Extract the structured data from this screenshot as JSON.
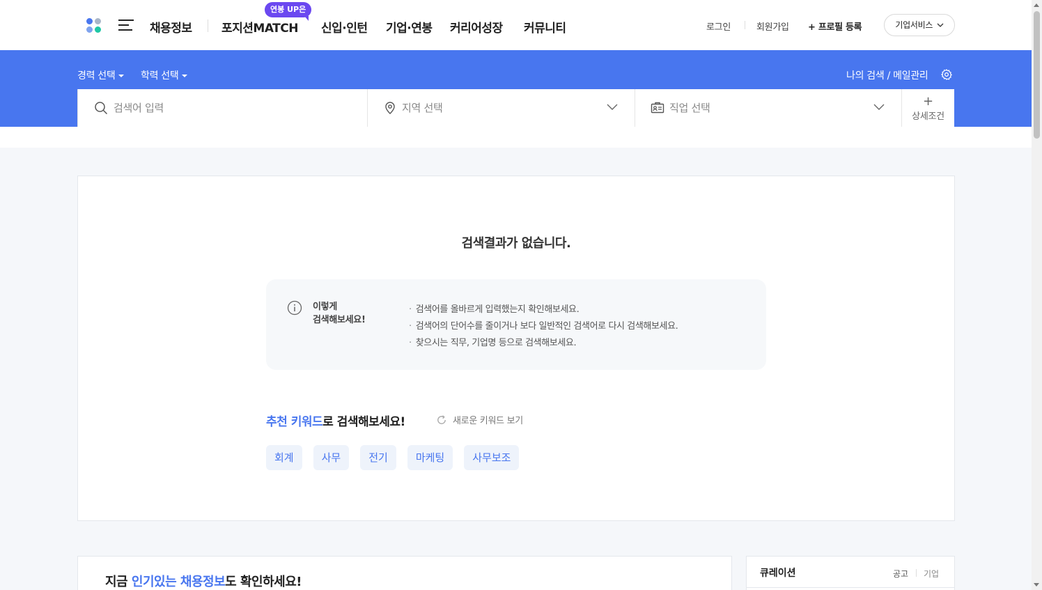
{
  "header": {
    "nav": [
      {
        "label": "채용정보"
      },
      {
        "label": "포지션MATCH"
      },
      {
        "label": "신입·인턴"
      },
      {
        "label": "기업·연봉"
      },
      {
        "label": "커리어성장"
      },
      {
        "label": "커뮤니티"
      }
    ],
    "match_badge": "연봉 UP은",
    "util": {
      "login": "로그인",
      "signup": "회원가입",
      "profile": "+ 프로필 등록",
      "biz": "기업서비스"
    },
    "logo_colors": [
      "#4876ef",
      "#a9b6c9",
      "#7fa3ee",
      "#1fc7a5"
    ]
  },
  "search": {
    "filters": {
      "career": "경력 선택",
      "education": "학력 선택"
    },
    "my_search": "나의 검색 / 메일관리",
    "keyword_placeholder": "검색어 입력",
    "region_placeholder": "지역 선택",
    "job_placeholder": "직업 선택",
    "detail_label": "상세조건"
  },
  "result": {
    "empty_message": "검색결과가 없습니다.",
    "tip_title_line1": "이렇게",
    "tip_title_line2": "검색해보세요!",
    "tips": [
      "검색어를 올바르게 입력했는지 확인해보세요.",
      "검색어의 단어수를 줄이거나 보다 일반적인 검색어로 다시 검색해보세요.",
      "찾으시는 직무, 기업명 등으로 검색해보세요."
    ],
    "rec_highlight": "추천 키워드",
    "rec_rest": "로 검색해보세요!",
    "refresh_label": "새로운 키워드 보기",
    "keywords": [
      "회계",
      "사무",
      "전기",
      "마케팅",
      "사무보조"
    ]
  },
  "popular": {
    "prefix": "지금 ",
    "highlight": "인기있는 채용정보",
    "suffix": "도 확인하세요!"
  },
  "curation": {
    "title": "큐레이션",
    "tab_posting": "공고",
    "tab_company": "기업"
  },
  "colors": {
    "primary": "#4876ef",
    "badge": "#6b48f0"
  }
}
